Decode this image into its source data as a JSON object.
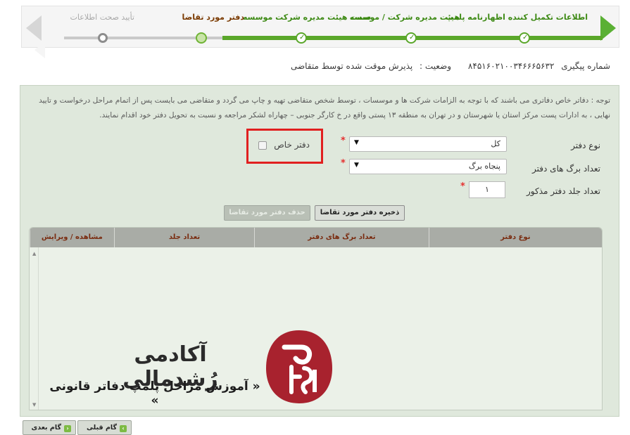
{
  "wizard": {
    "steps": [
      {
        "label": "اطلاعات تکمیل کننده اظهارنامه پلمپ",
        "state": "done"
      },
      {
        "label": "هیئت مدیره شرکت / موسسه",
        "state": "done"
      },
      {
        "label": "سمت هیئت مدیره شرکت موسسه",
        "state": "done"
      },
      {
        "label": "دفتر مورد تقاضا",
        "state": "current"
      },
      {
        "label": "تأیید صحت اطلاعات",
        "state": "pending"
      }
    ]
  },
  "tracking": {
    "tracking_label": "شماره پیگیری",
    "tracking_number": "۸۴۵۱۶۰۲۱۰۰۳۴۶۶۶۵۶۳۲",
    "status_label": "وضعیت :",
    "status_value": "پذیرش موقت شده توسط متقاضی"
  },
  "note": "توجه : دفاتر خاص دفاتری می باشند که با توجه به الزامات شرکت ها و موسسات ، توسط شخص متقاضی تهیه و چاپ می گردد و متقاضی می بایست پس از اتمام مراحل درخواست و تایید نهایی ، به ادارات پست مرکز استان یا شهرستان و در تهران به منطقه ۱۳ پستی واقع در خ کارگر جنوبی – چهاراه لشکر مراجعه و نسبت به تحویل دفتر خود اقدام نمایند.",
  "form": {
    "book_type_label": "نوع دفتر",
    "book_type_value": "کل",
    "pages_label": "تعداد برگ های دفتر",
    "pages_value": "پنجاه برگ",
    "volumes_label": "تعداد جلد دفتر مذکور",
    "volumes_value": "۱",
    "special_label": "دفتر خاص",
    "special_checked": false,
    "required_mark": "*"
  },
  "buttons": {
    "save": "ذخیره دفتر مورد تقاضا",
    "delete": "حذف دفتر مورد تقاضا",
    "prev": "گام قبلی",
    "next": "گام بعدی"
  },
  "grid": {
    "columns": [
      "نوع دفتر",
      "تعداد برگ های دفتر",
      "تعداد جلد",
      "مشاهده / ویرایش"
    ],
    "rows": []
  },
  "watermark": {
    "title": "آکادمی رُشدمالی",
    "subtitle": "« آموزش مراحل پلمپ دفاتر قانونی »"
  },
  "colors": {
    "accent_green": "#5aa72a",
    "highlight_red": "#e12020",
    "panel_bg": "#dfe8dc",
    "logo_red": "#a8222e"
  }
}
